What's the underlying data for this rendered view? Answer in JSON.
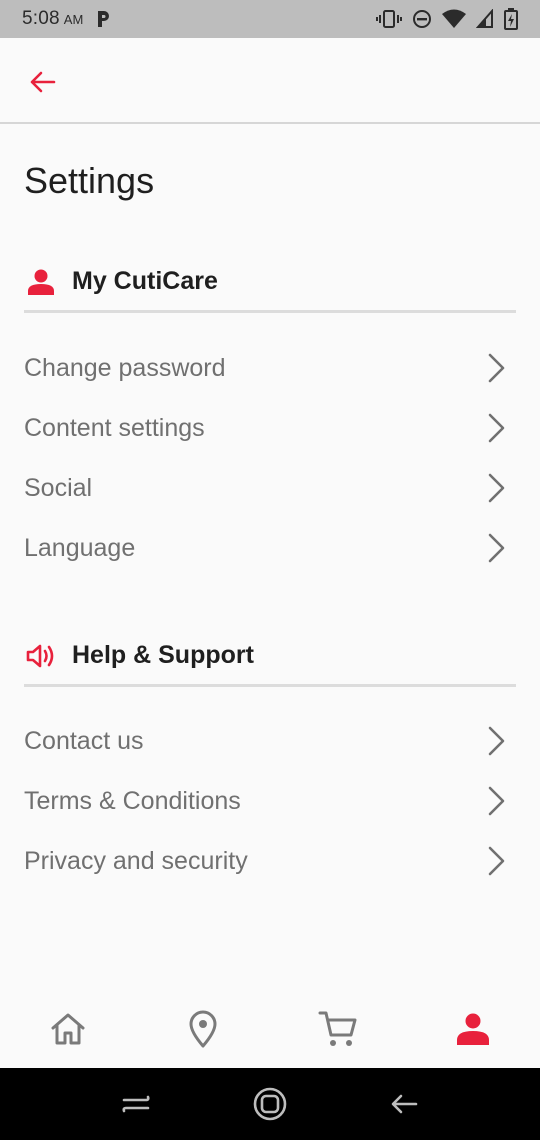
{
  "status_bar": {
    "time": "5:08",
    "ampm": "AM"
  },
  "header": {
    "back_icon": "arrow-left-icon"
  },
  "page": {
    "title": "Settings"
  },
  "sections": [
    {
      "title": "My CutiCare",
      "icon": "person-icon",
      "items": [
        {
          "label": "Change password"
        },
        {
          "label": "Content settings"
        },
        {
          "label": "Social"
        },
        {
          "label": "Language"
        }
      ]
    },
    {
      "title": "Help & Support",
      "icon": "speaker-icon",
      "items": [
        {
          "label": "Contact us"
        },
        {
          "label": "Terms & Conditions"
        },
        {
          "label": "Privacy and security"
        }
      ]
    }
  ],
  "bottom_nav": {
    "items": [
      {
        "icon": "home-icon",
        "active": false
      },
      {
        "icon": "location-pin-icon",
        "active": false
      },
      {
        "icon": "cart-icon",
        "active": false
      },
      {
        "icon": "person-icon",
        "active": true
      }
    ]
  },
  "colors": {
    "accent": "#e8213c",
    "text_primary": "#1f1f1f",
    "text_secondary": "#707070",
    "divider": "#dcdcdc"
  }
}
